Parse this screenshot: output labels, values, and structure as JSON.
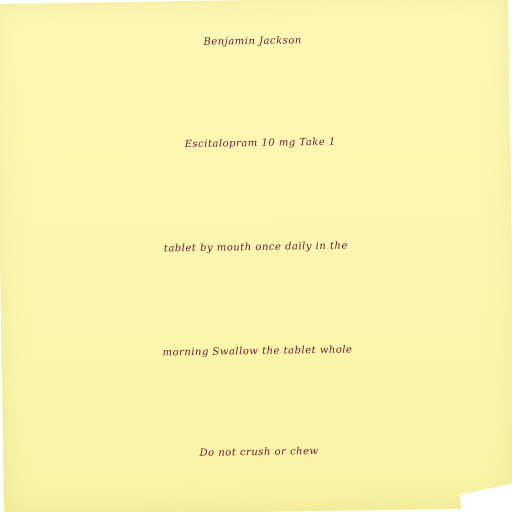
{
  "note": {
    "background_color": "#fbf7ad",
    "ink_color": "#6e1239",
    "lines": [
      "Benjamin Jackson",
      "Escitalopram 10 mg Take 1",
      "tablet by mouth once daily in the",
      "morning Swallow the tablet whole",
      "Do not crush or chew"
    ]
  }
}
